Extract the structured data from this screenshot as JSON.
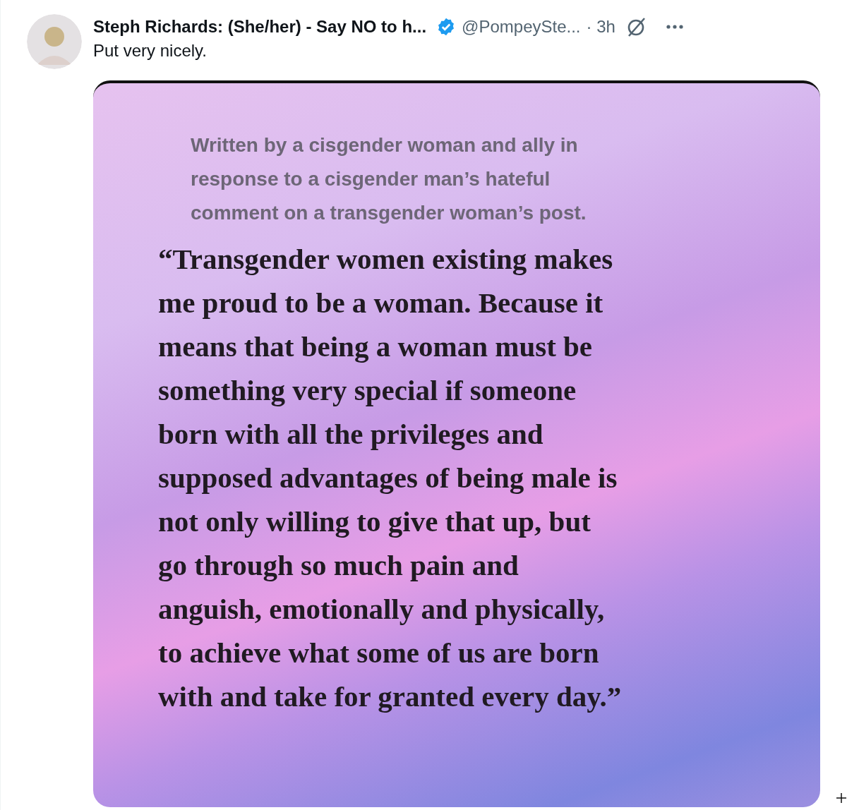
{
  "post": {
    "author": "Steph Richards: (She/her) - Say NO to h...",
    "verified": true,
    "handle": "@PompeySte...",
    "time": "· 3h",
    "text": "Put very nicely.",
    "image": {
      "intro_lines": [
        "Written by a cisgender woman and ally in",
        "response to a cisgender man’s hateful",
        "comment on a transgender woman’s post."
      ],
      "quote_lines": [
        "“Transgender women existing makes",
        "me proud to be a woman. Because it",
        "means that being a woman must be",
        "something very special if someone",
        "born with all the privileges and",
        "supposed advantages of being male is",
        "not only willing to give that up, but",
        "go through so much pain and",
        "anguish, emotionally and physically,",
        "to achieve what some of us are born",
        "with and take for granted every day.”"
      ]
    }
  }
}
